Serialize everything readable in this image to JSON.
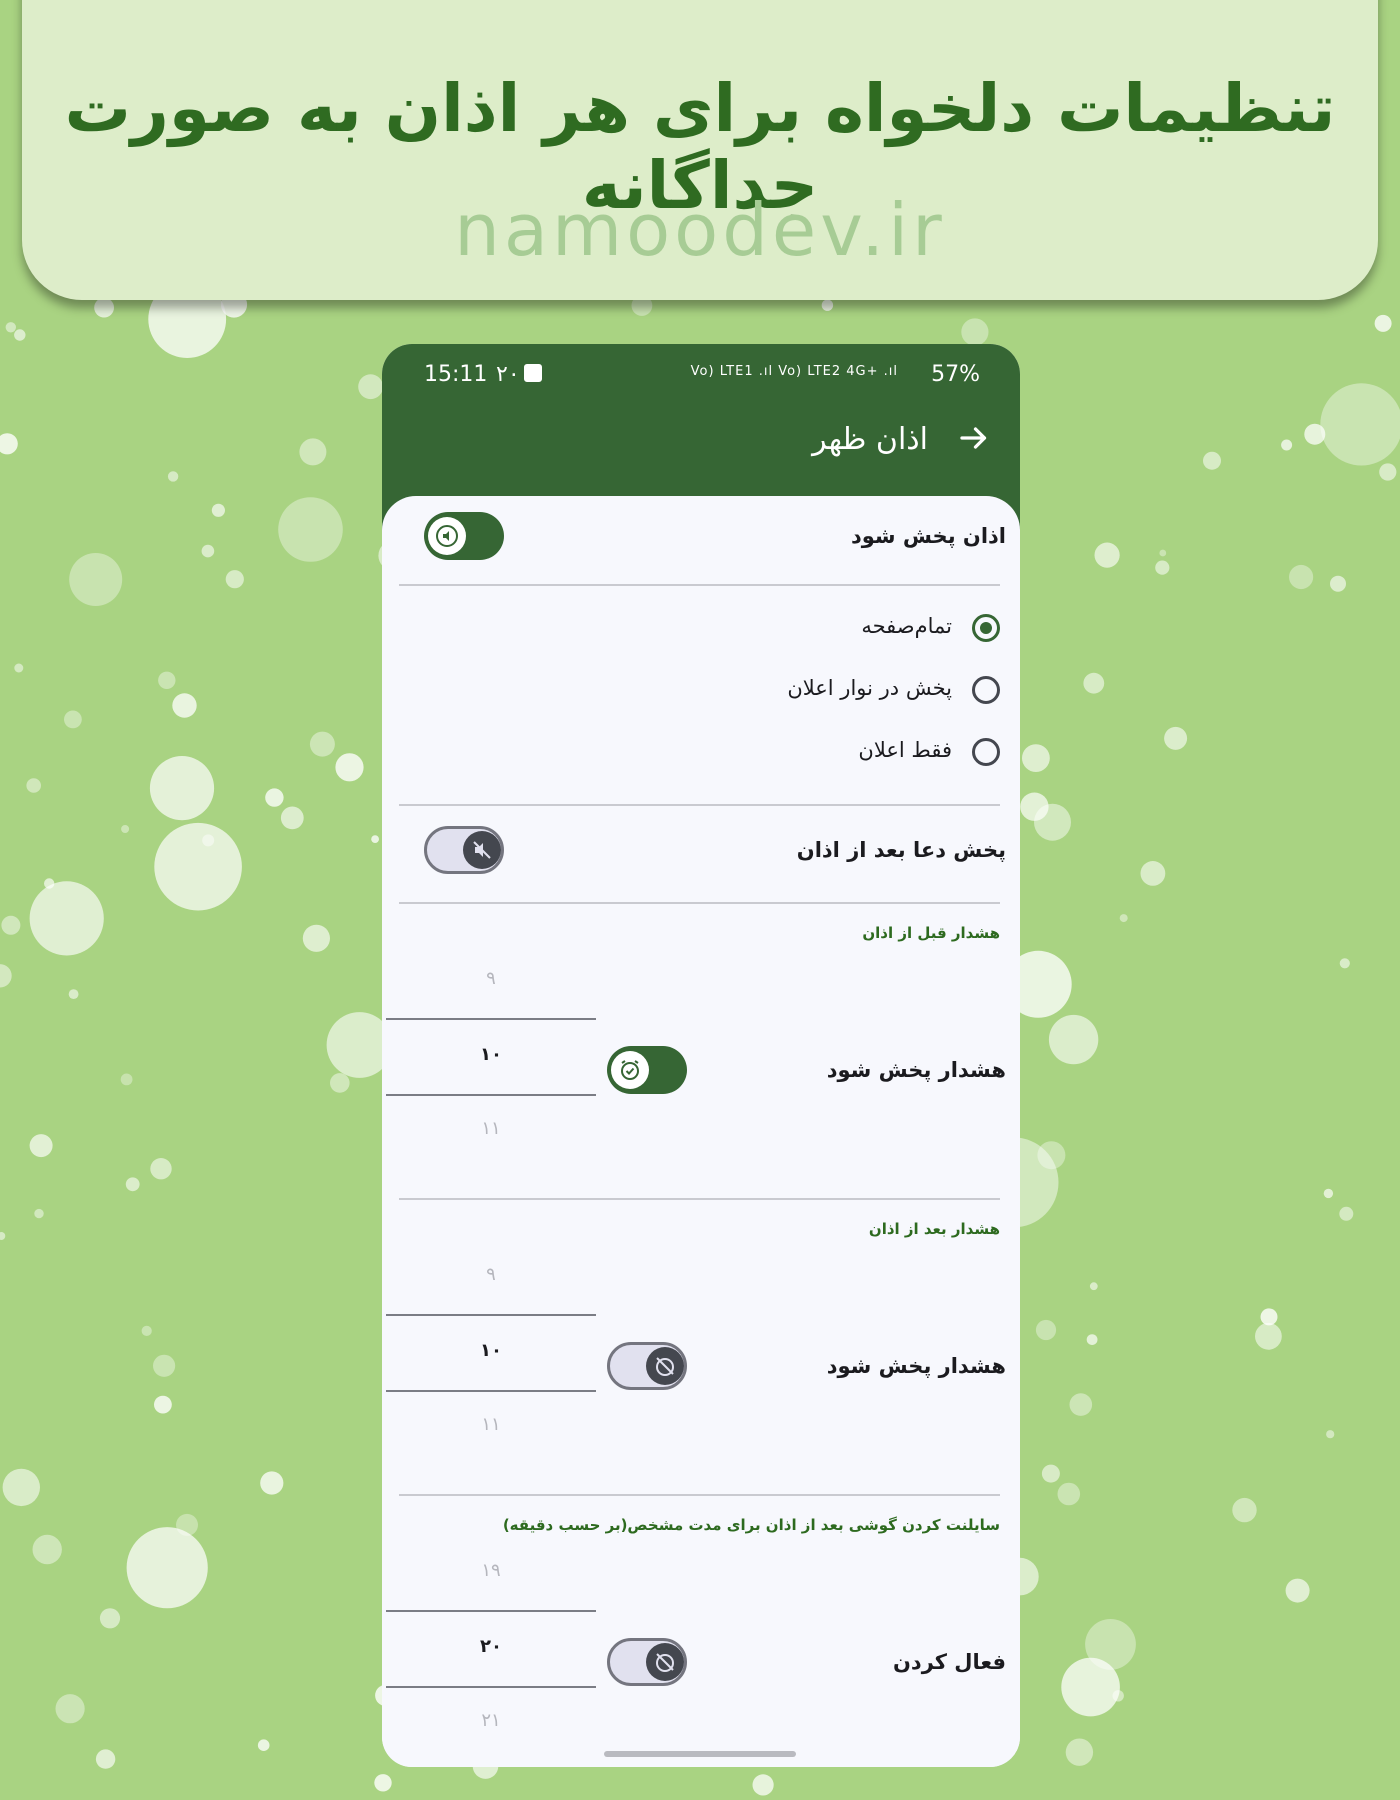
{
  "banner": {
    "title": "تنظیمات دلخواه برای هر اذان به صورت جداگانه",
    "site": "namoodev.ir"
  },
  "status_bar": {
    "time": "15:11",
    "notification_count": "۲۰",
    "network_icons": "Vo) LTE1 .ıl Vo) LTE2 4G+ .ıl",
    "battery": "57%"
  },
  "app_bar": {
    "title": "اذان ظهر",
    "back_icon": "arrow-back-icon"
  },
  "adhan_play": {
    "label": "اذان پخش شود",
    "enabled": true,
    "icon": "speaker-icon"
  },
  "display_mode": {
    "options": [
      {
        "label": "تمام‌صفحه",
        "selected": true
      },
      {
        "label": "پخش در نوار اعلان",
        "selected": false
      },
      {
        "label": "فقط اعلان",
        "selected": false
      }
    ]
  },
  "dua_after": {
    "label": "پخش دعا بعد از اذان",
    "enabled": false,
    "icon": "speaker-off-icon"
  },
  "warning_before": {
    "section_label": "هشدار قبل از اذان",
    "label": "هشدار پخش شود",
    "enabled": true,
    "icon": "alarm-check-icon",
    "picker": {
      "prev": "۹",
      "current": "۱۰",
      "next": "۱۱"
    }
  },
  "warning_after": {
    "section_label": "هشدار بعد از اذان",
    "label": "هشدار پخش شود",
    "enabled": false,
    "icon": "alarm-off-icon",
    "picker": {
      "prev": "۹",
      "current": "۱۰",
      "next": "۱۱"
    }
  },
  "silent_mode": {
    "section_label": "سایلنت کردن گوشی بعد از اذان برای مدت مشخص(بر حسب دقیقه)",
    "label": "فعال کردن",
    "enabled": false,
    "icon": "alarm-off-icon",
    "picker": {
      "prev": "۱۹",
      "current": "۲۰",
      "next": "۲۱"
    }
  },
  "colors": {
    "primary": "#366634",
    "background": "#a9d382",
    "banner": "#ddedc9",
    "banner_title": "#2f6b21",
    "surface": "#f7f8fd"
  }
}
